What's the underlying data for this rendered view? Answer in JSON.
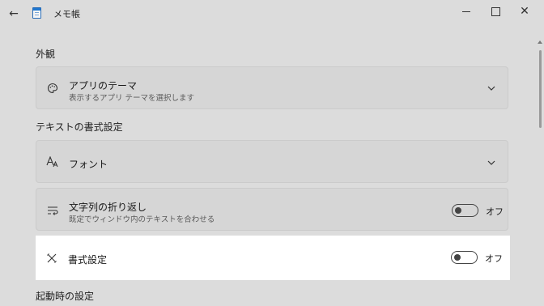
{
  "window": {
    "title": "メモ帳",
    "back_icon": "back-arrow-icon",
    "controls": [
      "minimize",
      "maximize",
      "close"
    ]
  },
  "sections": {
    "appearance": {
      "label": "外観"
    },
    "text_format": {
      "label": "テキストの書式設定"
    },
    "startup": {
      "label": "起動時の設定"
    }
  },
  "settings": {
    "theme": {
      "title": "アプリのテーマ",
      "subtitle": "表示するアプリ テーマを選択します",
      "icon": "palette-icon"
    },
    "font": {
      "title": "フォント",
      "icon": "font-icon"
    },
    "word_wrap": {
      "title": "文字列の折り返し",
      "subtitle": "既定でウィンドウ内のテキストを合わせる",
      "icon": "wrap-icon",
      "toggle_label": "オフ",
      "enabled": false
    },
    "formatting": {
      "title": "書式設定",
      "icon": "formatting-icon",
      "toggle_label": "オフ",
      "enabled": false
    }
  },
  "colors": {
    "background": "#dcdcdc",
    "card": "#d6d6d6",
    "highlight": "#ffffff"
  }
}
